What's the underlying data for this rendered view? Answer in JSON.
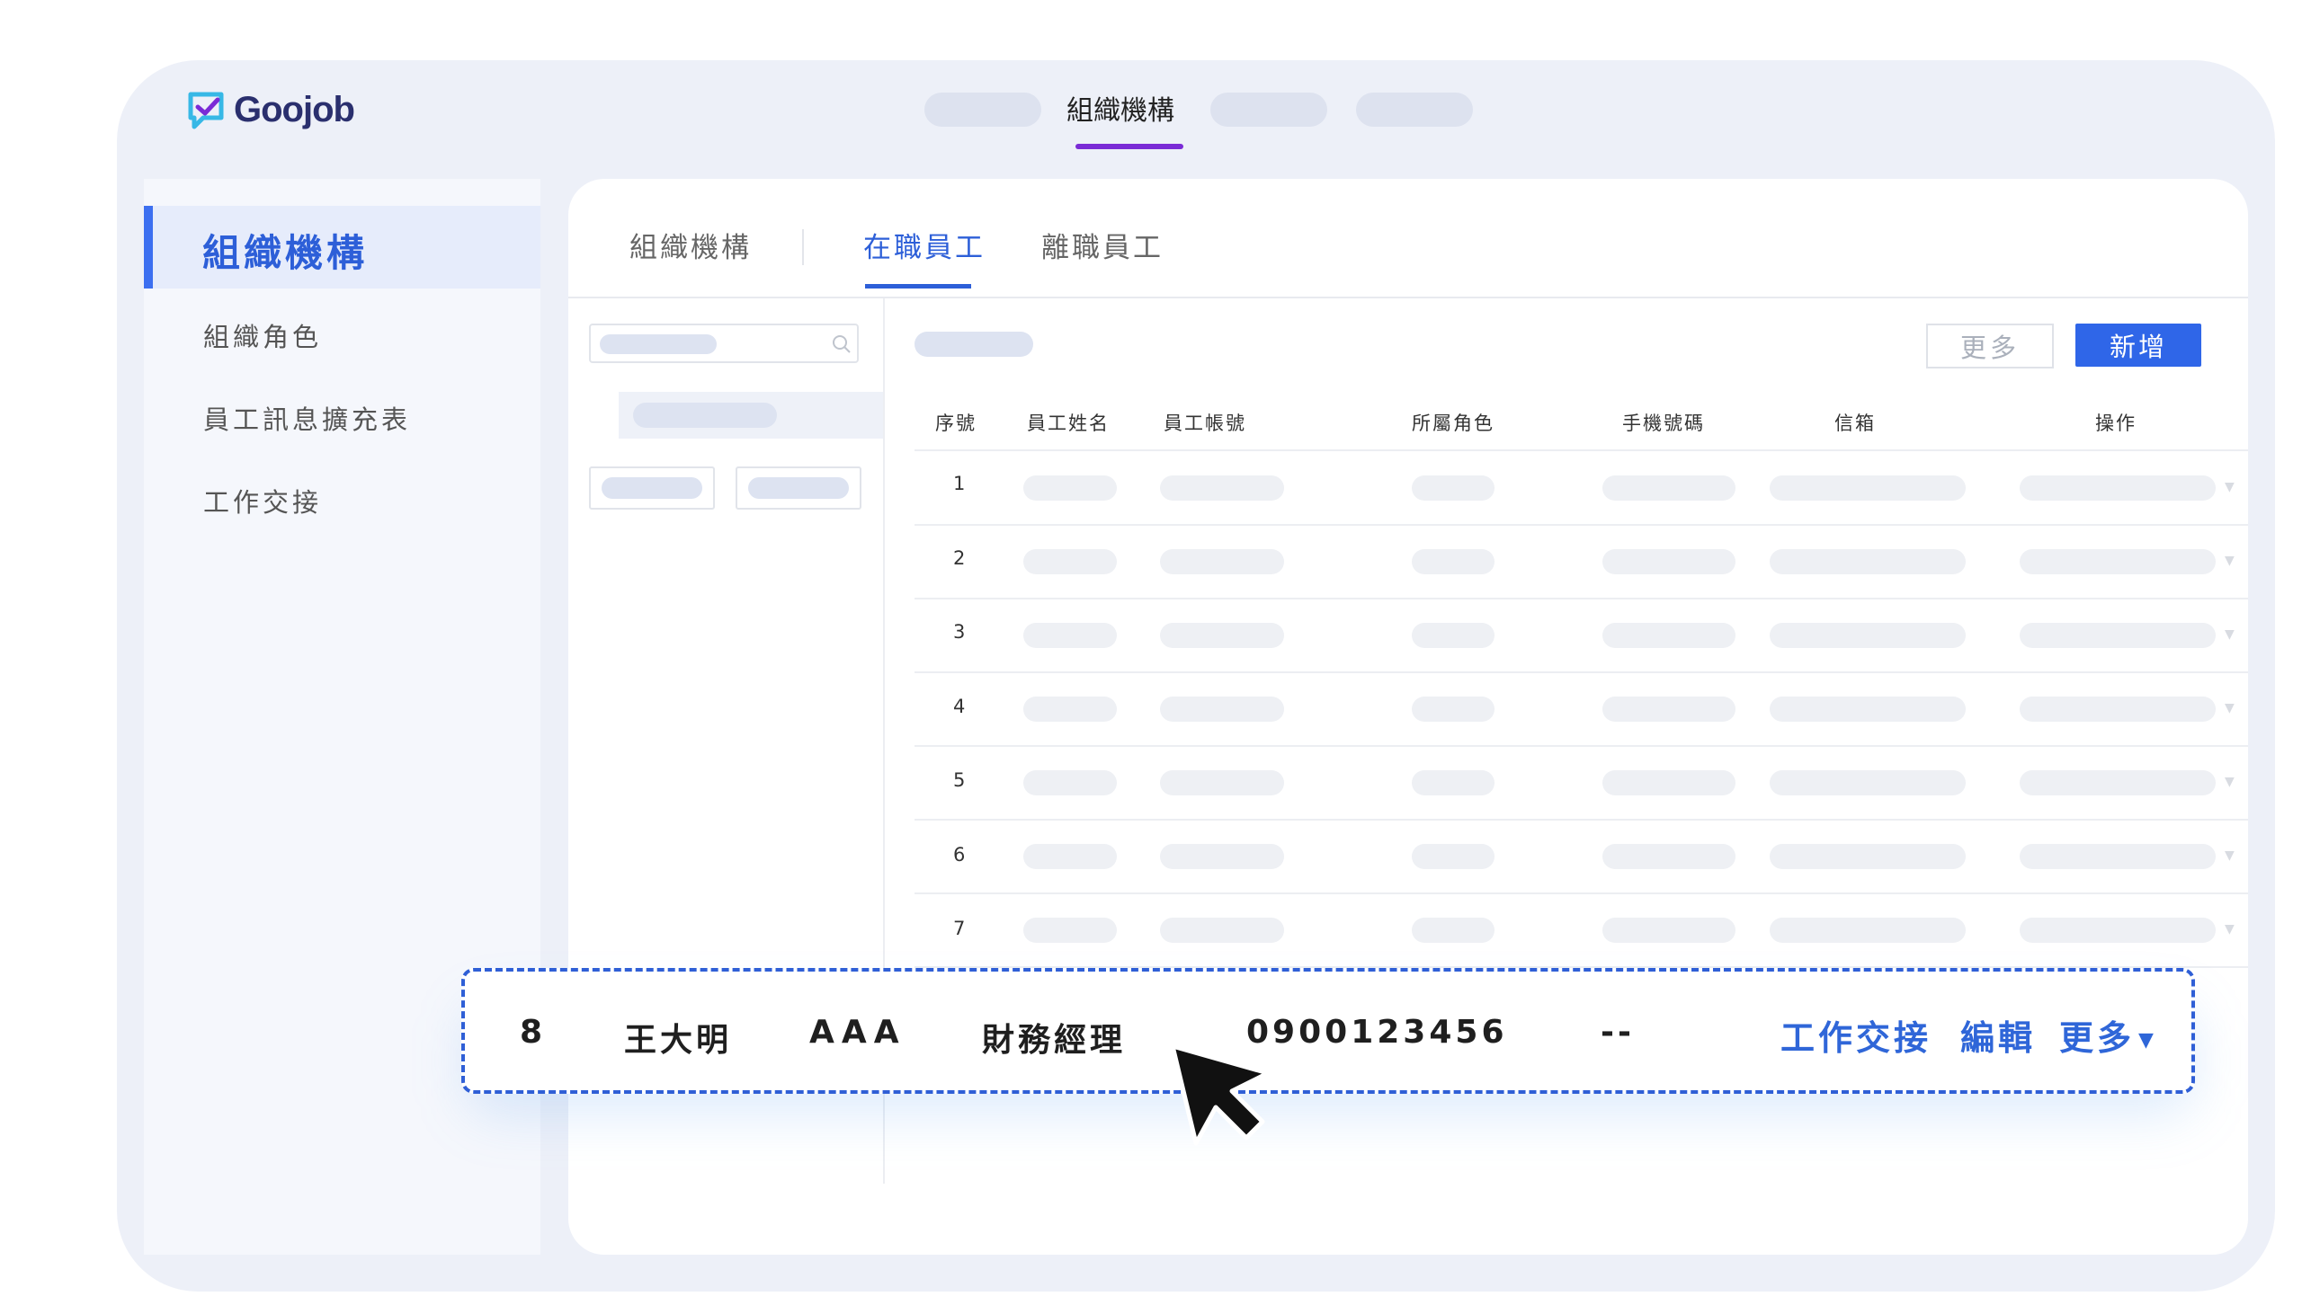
{
  "brand": {
    "name": "Goojob"
  },
  "top_nav": {
    "active_label": "組織機構"
  },
  "sidebar": {
    "active": "組織機構",
    "items": [
      "組織角色",
      "員工訊息擴充表",
      "工作交接"
    ]
  },
  "tabs": [
    "組織機構",
    "在職員工",
    "離職員工"
  ],
  "toolbar": {
    "more_label": "更多",
    "add_label": "新增"
  },
  "table": {
    "headers": [
      "序號",
      "員工姓名",
      "員工帳號",
      "所屬角色",
      "手機號碼",
      "信箱",
      "操作"
    ],
    "row_indices": [
      "1",
      "2",
      "3",
      "4",
      "5",
      "6",
      "7"
    ]
  },
  "highlight_row": {
    "index": "8",
    "name": "王大明",
    "account": "AAA",
    "role": "財務經理",
    "phone": "0900123456",
    "email": "--",
    "actions": {
      "handover": "工作交接",
      "edit": "編輯",
      "more": "更多"
    }
  },
  "colors": {
    "accent": "#2f66e8",
    "nav_underline": "#7a2bd6",
    "frame": "#edf0f8"
  }
}
